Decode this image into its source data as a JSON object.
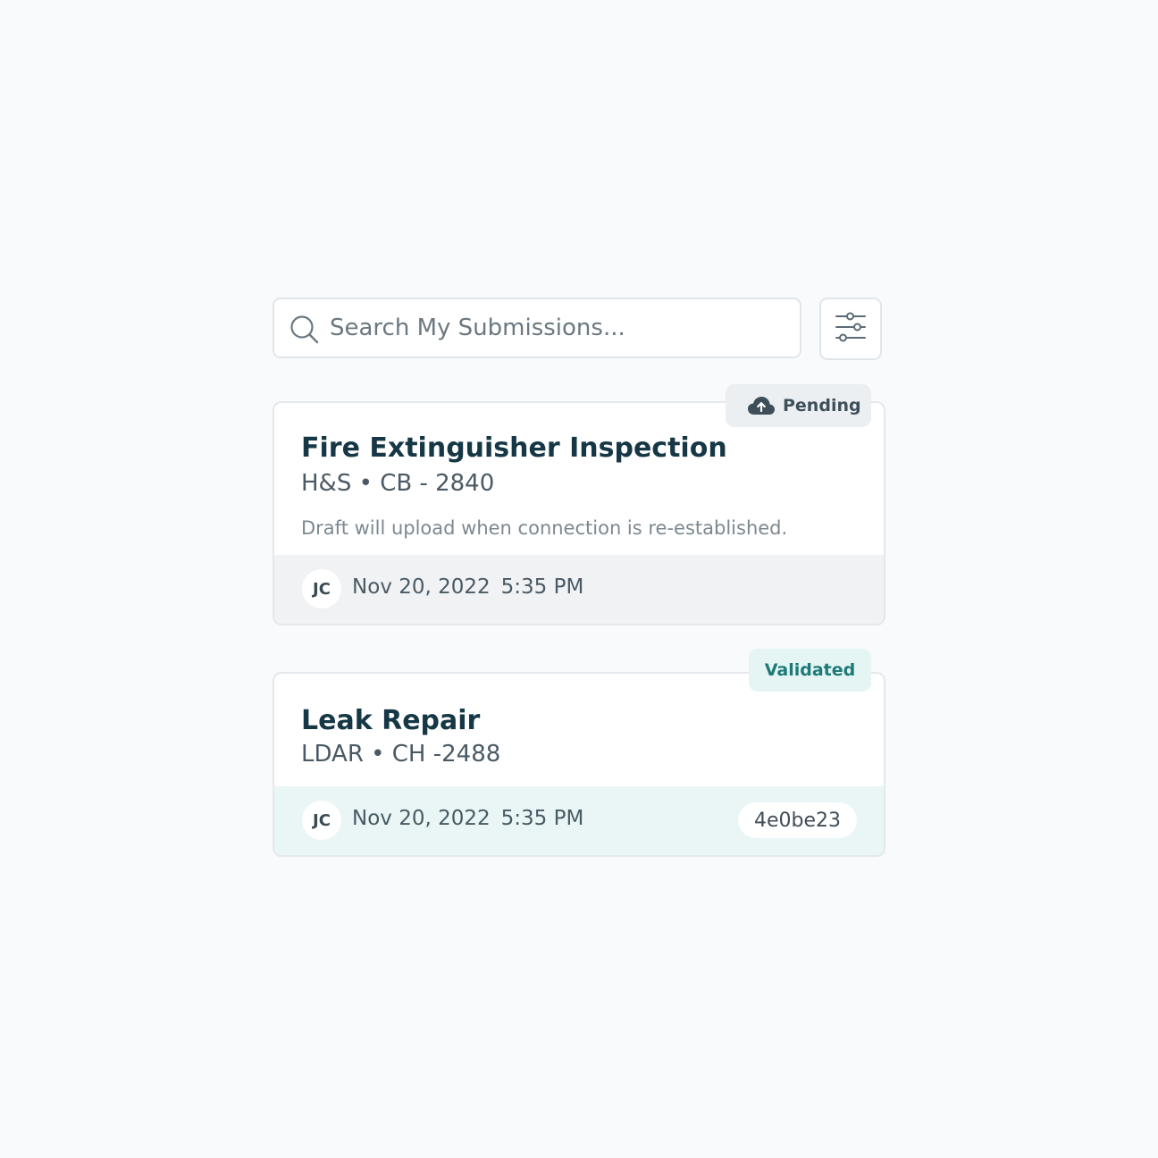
{
  "search": {
    "placeholder": "Search My Submissions..."
  },
  "submissions": [
    {
      "status": "Pending",
      "title": "Fire Extinguisher Inspection",
      "subtitle": "H&S • CB - 2840",
      "note": "Draft will upload when connection is re-established.",
      "author_initials": "JC",
      "date": "Nov 20, 2022",
      "time": "5:35 PM"
    },
    {
      "status": "Validated",
      "title": "Leak Repair",
      "subtitle": "LDAR • CH -2488",
      "author_initials": "JC",
      "date": "Nov 20, 2022",
      "time": "5:35 PM",
      "hash": "4e0be23"
    }
  ],
  "icons": {
    "search": "search-icon",
    "filter": "sliders-icon",
    "upload": "cloud-upload-icon"
  },
  "colors": {
    "background": "#f8fafc",
    "title": "#163746",
    "pending_badge": "#eceff2",
    "validated_badge": "#e4f5f3",
    "validated_text": "#1d7a78",
    "validated_footer": "#e9f6f5",
    "pending_footer": "#f0f2f4"
  }
}
